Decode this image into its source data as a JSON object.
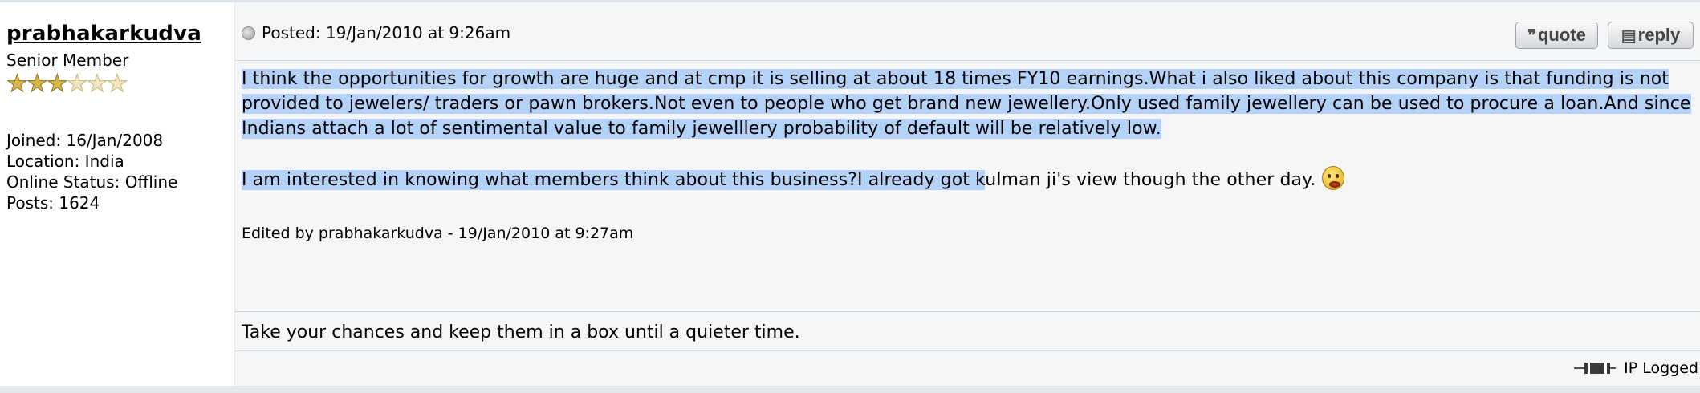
{
  "author": {
    "name": "prabhakarkudva",
    "rank": "Senior Member",
    "stars": {
      "filled": 3,
      "total": 6
    },
    "joined": "Joined: 16/Jan/2008",
    "location": "Location: India",
    "online_status": "Online Status: Offline",
    "posts": "Posts: 1624"
  },
  "post": {
    "status_icon": "offline-dot-icon",
    "posted": "Posted: 19/Jan/2010 at 9:26am",
    "buttons": {
      "quote_label": "quote",
      "reply_label": "reply"
    },
    "body": {
      "para1": "I think the opportunities for growth are huge and at cmp it is selling at about 18 times FY10 earnings.What i also liked about this company is that funding is not provided to jewelers/ traders or pawn brokers.Not even to people who get brand new jewellery.Only used family jewellery can be used to procure a loan.And since Indians attach a lot of sentimental value to family jewelllery probability of default will be relatively low.",
      "para2_selected": "I am interested in knowing what members think about this business?I already got k",
      "para2_rest": "ulman ji's view though the other day."
    },
    "edited": "Edited by prabhakarkudva - 19/Jan/2010 at 9:27am",
    "signature": "Take your chances and keep them in a box until a quieter time.",
    "ip_logged": "IP Logged"
  },
  "colors": {
    "selection": "#b4d1f8",
    "content_bg": "#f5f6f8",
    "star_filled": "#d8b64a"
  }
}
